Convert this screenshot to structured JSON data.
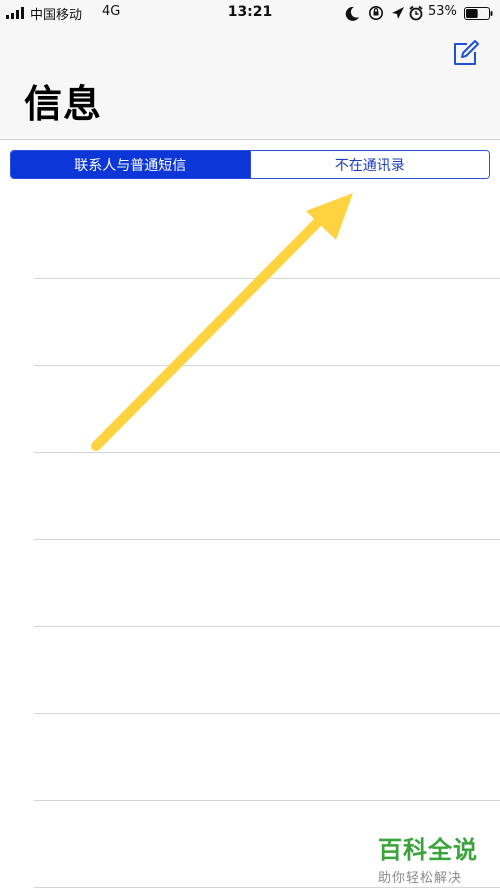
{
  "status_bar": {
    "carrier": "中国移动",
    "network": "4G",
    "time": "13:21",
    "battery_percent": "53%",
    "battery_level": 0.53,
    "icons": [
      "signal-icon",
      "moon-icon",
      "rotation-lock-icon",
      "location-icon",
      "alarm-icon",
      "battery-icon"
    ]
  },
  "header": {
    "title": "信息",
    "compose_icon": "compose-icon"
  },
  "segmented_control": {
    "options": [
      "联系人与普通短信",
      "不在通讯录"
    ],
    "selected_index": 0
  },
  "colors": {
    "accent": "#0c36d8",
    "annotation_arrow": "#ffd23f",
    "watermark_brand": "#3aa33a"
  },
  "overlay": {
    "arrow_icon": "arrow-icon"
  },
  "watermark": {
    "brand": "百科全说",
    "slogan": "助你轻松解决"
  }
}
